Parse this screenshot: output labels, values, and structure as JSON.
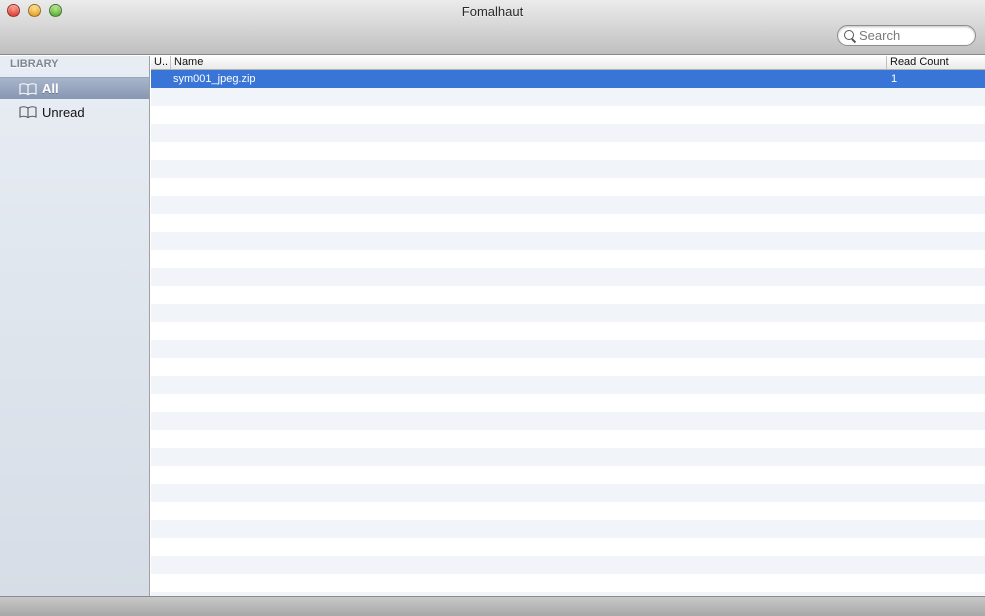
{
  "window": {
    "title": "Fomalhaut",
    "traffic_lights": [
      "close",
      "minimize",
      "zoom"
    ]
  },
  "search": {
    "placeholder": "Search",
    "value": ""
  },
  "sidebar": {
    "heading": "LIBRARY",
    "items": [
      {
        "label": "All",
        "icon": "book-icon",
        "selected": true
      },
      {
        "label": "Unread",
        "icon": "book-icon",
        "selected": false
      }
    ]
  },
  "table": {
    "columns": [
      {
        "label": "U.."
      },
      {
        "label": "Name"
      },
      {
        "label": "Read Count"
      }
    ],
    "rows": [
      {
        "unread": "",
        "name": "sym001_jpeg.zip",
        "read_count": "1",
        "selected": true
      }
    ]
  },
  "colors": {
    "selection": "#3875d7",
    "sidebar_selection": "#8796b1",
    "stripe": "#f1f5fa"
  }
}
